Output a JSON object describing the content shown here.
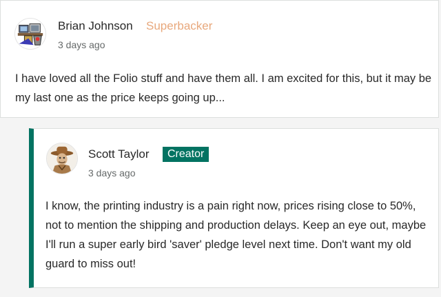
{
  "comment": {
    "author": "Brian Johnson",
    "badge": "Superbacker",
    "time": "3 days ago",
    "avatar_icon": "desk-robot-avatar",
    "text": "I have loved all the Folio stuff and have them all. I am excited for this, but it may be my last one as the price keeps going up..."
  },
  "reply": {
    "author": "Scott Taylor",
    "badge": "Creator",
    "time": "3 days ago",
    "avatar_icon": "cowboy-hat-avatar",
    "text": "I know, the printing industry is a pain right now, prices rising close to 50%, not to mention the shipping and production delays. Keep an eye out, maybe I'll run a super early bird 'saver' pledge level next time. Don't want my old guard to miss out!"
  },
  "colors": {
    "superbacker": "#e8a87c",
    "creator": "#037362",
    "text": "#282828",
    "muted": "#656969",
    "background": "#f4f4f4"
  }
}
